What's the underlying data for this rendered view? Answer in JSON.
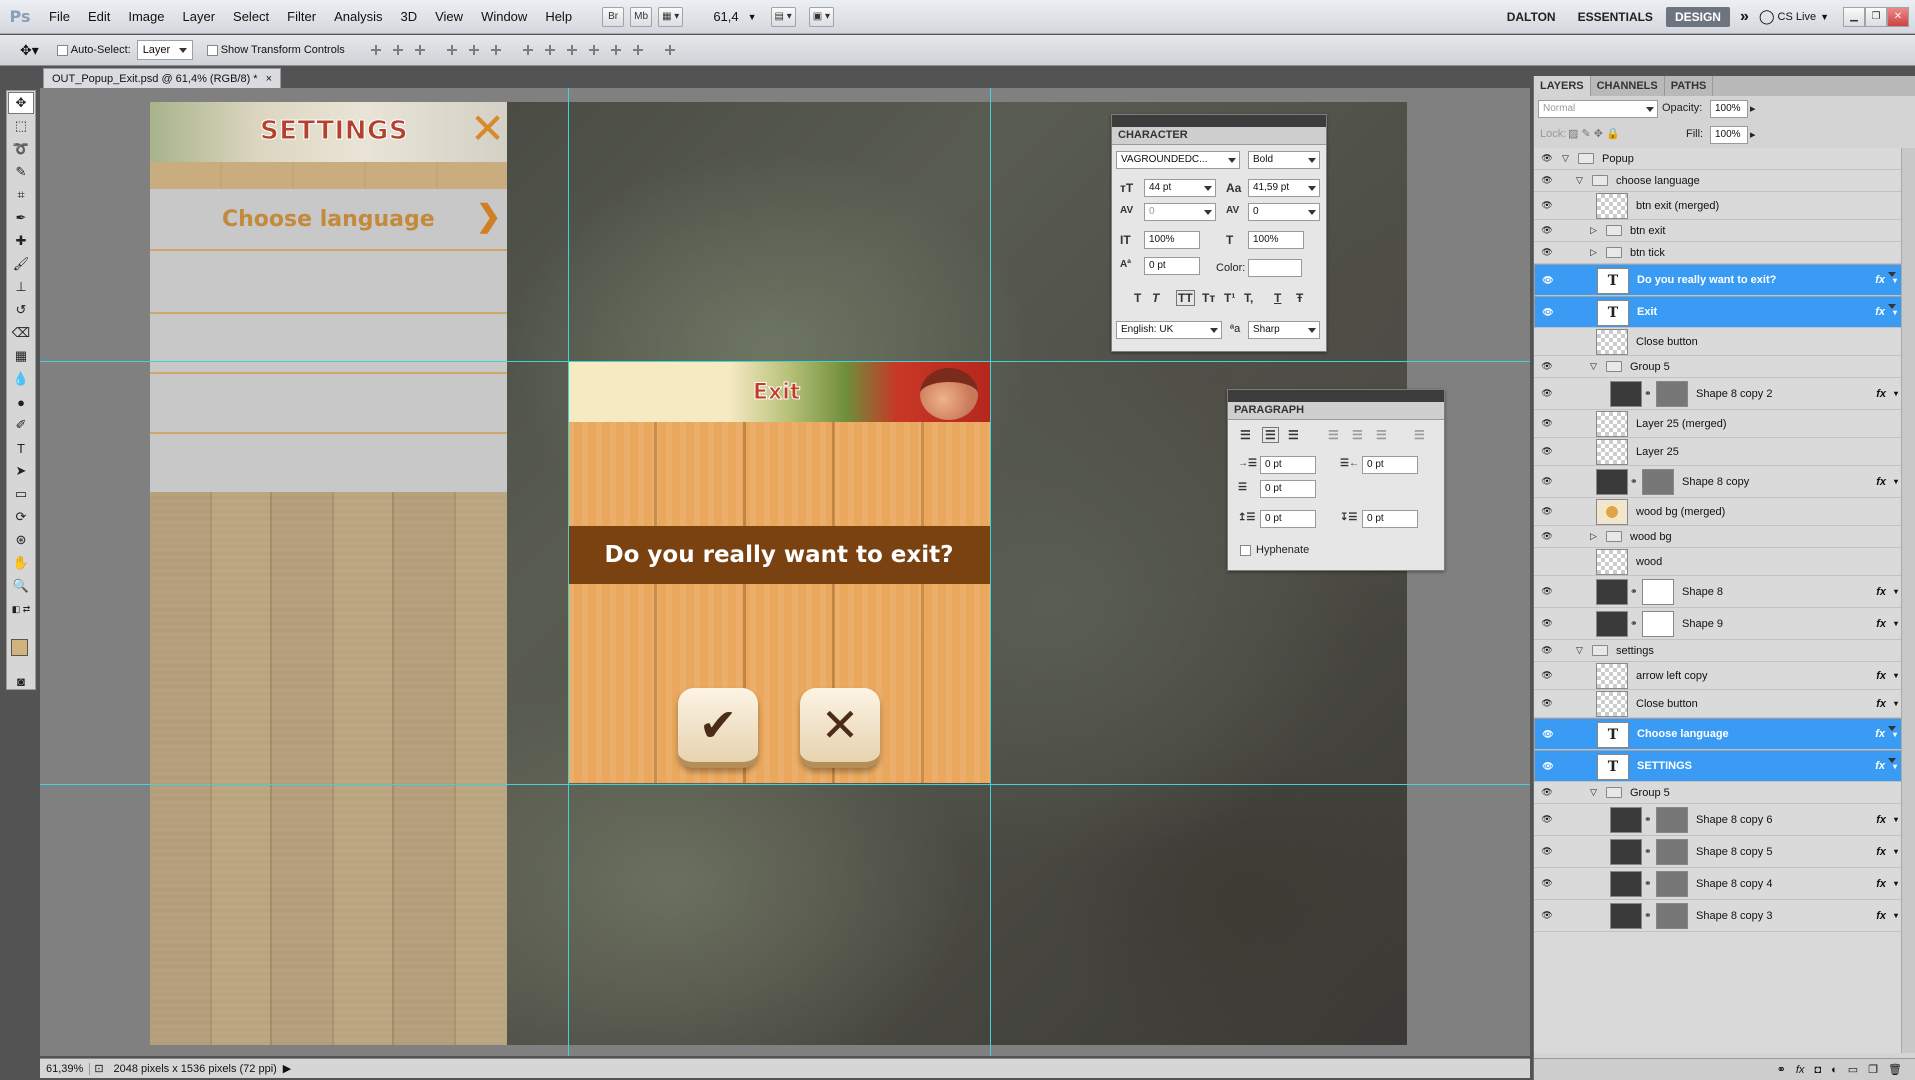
{
  "menubar": {
    "logo": "Ps",
    "items": [
      "File",
      "Edit",
      "Image",
      "Layer",
      "Select",
      "Filter",
      "Analysis",
      "3D",
      "View",
      "Window",
      "Help"
    ],
    "bridge": "Br",
    "minibridge": "Mb",
    "zoom": "61,4",
    "workspaces": [
      "DALTON",
      "ESSENTIALS",
      "DESIGN"
    ],
    "cslive": "CS Live"
  },
  "options": {
    "auto_select": "Auto-Select:",
    "auto_select_value": "Layer",
    "show_transform": "Show Transform Controls"
  },
  "document": {
    "tab": "OUT_Popup_Exit.psd @ 61,4% (RGB/8) *",
    "close": "×"
  },
  "artwork": {
    "settings_title": "SETTINGS",
    "settings_close": "✕",
    "choose_language": "Choose language",
    "arrow": "❯",
    "popup_title": "Exit",
    "question": "Do you really want to exit?",
    "tick": "✔",
    "cross": "✕"
  },
  "character": {
    "tab": "CHARACTER",
    "font": "VAGROUNDEDC...",
    "style": "Bold",
    "size": "44 pt",
    "leading": "41,59 pt",
    "kerning": "0",
    "tracking": "0",
    "vscale": "100%",
    "hscale": "100%",
    "baseline": "0 pt",
    "color_label": "Color:",
    "language": "English: UK",
    "aa_label": "ªa",
    "antialias": "Sharp",
    "styles": [
      "T",
      "T",
      "TT",
      "Tт",
      "T¹",
      "T,",
      "T",
      "Ŧ"
    ]
  },
  "paragraph": {
    "tab": "PARAGRAPH",
    "indent_left": "0 pt",
    "indent_right": "0 pt",
    "indent_first": "0 pt",
    "space_before": "0 pt",
    "space_after": "0 pt",
    "hyphenate": "Hyphenate"
  },
  "status": {
    "zoom": "61,39%",
    "info": "2048 pixels x 1536 pixels (72 ppi)"
  },
  "layers": {
    "tabs": [
      "LAYERS",
      "CHANNELS",
      "PATHS"
    ],
    "blend_mode": "Normal",
    "opacity_label": "Opacity:",
    "opacity": "100%",
    "lock_label": "Lock:",
    "fill_label": "Fill:",
    "fill": "100%",
    "fx": "fx",
    "rows": [
      {
        "name": "Popup",
        "type": "group",
        "indent": 0,
        "open": true,
        "eye": true
      },
      {
        "name": "choose language",
        "type": "group",
        "indent": 1,
        "open": true,
        "eye": true
      },
      {
        "name": "btn exit (merged)",
        "type": "pixel",
        "indent": 2,
        "eye": true
      },
      {
        "name": "btn exit",
        "type": "group",
        "indent": 2,
        "open": false,
        "eye": true
      },
      {
        "name": "btn tick",
        "type": "group",
        "indent": 2,
        "open": false,
        "eye": true
      },
      {
        "name": "Do you really want to exit?",
        "type": "text",
        "indent": 2,
        "eye": true,
        "selected": true,
        "fx": true
      },
      {
        "name": "Exit",
        "type": "text",
        "indent": 2,
        "eye": true,
        "selected": true,
        "fx": true
      },
      {
        "name": "Close button",
        "type": "smart",
        "indent": 2,
        "eye": false
      },
      {
        "name": "Group 5",
        "type": "group",
        "indent": 2,
        "open": true,
        "eye": true
      },
      {
        "name": "Shape 8 copy 2",
        "type": "shape",
        "indent": 3,
        "eye": true,
        "fx": true
      },
      {
        "name": "Layer 25 (merged)",
        "type": "pixel",
        "indent": 2,
        "eye": true
      },
      {
        "name": "Layer 25",
        "type": "pixel",
        "indent": 2,
        "eye": true
      },
      {
        "name": "Shape 8 copy",
        "type": "shape",
        "indent": 2,
        "eye": true,
        "fx": true
      },
      {
        "name": "wood bg (merged)",
        "type": "wood",
        "indent": 2,
        "eye": true
      },
      {
        "name": "wood bg",
        "type": "group",
        "indent": 2,
        "open": false,
        "eye": true
      },
      {
        "name": "wood",
        "type": "pixel",
        "indent": 2,
        "eye": false
      },
      {
        "name": "Shape 8",
        "type": "shape",
        "indent": 2,
        "eye": true,
        "fx": true,
        "mask": "white"
      },
      {
        "name": "Shape 9",
        "type": "shape",
        "indent": 2,
        "eye": true,
        "fx": true,
        "mask": "white"
      },
      {
        "name": "settings",
        "type": "group",
        "indent": 1,
        "open": true,
        "eye": true
      },
      {
        "name": "arrow left copy",
        "type": "smart",
        "indent": 2,
        "eye": true,
        "fx": true
      },
      {
        "name": "Close button",
        "type": "smart",
        "indent": 2,
        "eye": true,
        "fx": true
      },
      {
        "name": "Choose language",
        "type": "text",
        "indent": 2,
        "eye": true,
        "selected": true,
        "fx": true
      },
      {
        "name": "SETTINGS",
        "type": "text",
        "indent": 2,
        "eye": true,
        "selected": true,
        "fx": true
      },
      {
        "name": "Group 5",
        "type": "group",
        "indent": 2,
        "open": true,
        "eye": true
      },
      {
        "name": "Shape 8 copy 6",
        "type": "shape",
        "indent": 3,
        "eye": true,
        "fx": true
      },
      {
        "name": "Shape 8 copy 5",
        "type": "shape",
        "indent": 3,
        "eye": true,
        "fx": true
      },
      {
        "name": "Shape 8 copy 4",
        "type": "shape",
        "indent": 3,
        "eye": true,
        "fx": true
      },
      {
        "name": "Shape 8 copy 3",
        "type": "shape",
        "indent": 3,
        "eye": true,
        "fx": true
      }
    ]
  }
}
